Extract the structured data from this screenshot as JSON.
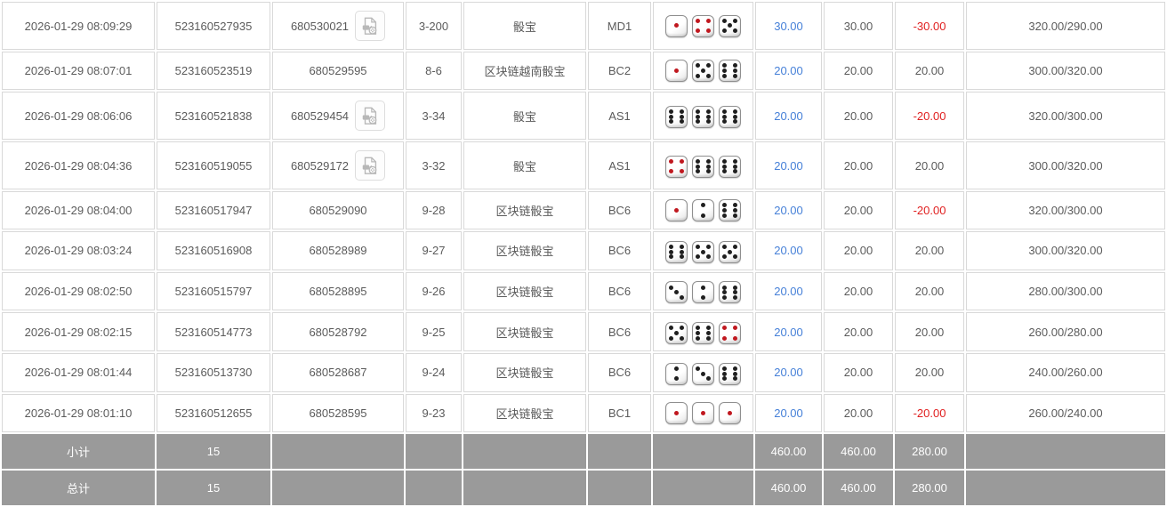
{
  "colors": {
    "accent_blue": "#4680d8",
    "negative_red": "#e02020",
    "text_gray": "#5b5b5b",
    "footer_gray": "#9a9a9a",
    "cell_border": "#d9d9d9",
    "pip_red": "#c0181f",
    "pip_black": "#1f1f1f"
  },
  "icons": {
    "video_replay": "video-replay-icon"
  },
  "table": {
    "rows": [
      {
        "time": "2026-01-29 08:09:29",
        "bet_id": "523160527935",
        "round_id": "680530021",
        "has_video": true,
        "round_no": "3-200",
        "game": "骰宝",
        "table_code": "MD1",
        "dice": [
          1,
          4,
          5
        ],
        "bet_amount": "30.00",
        "valid_amount": "30.00",
        "win_loss": "-30.00",
        "balance": "320.00/290.00"
      },
      {
        "time": "2026-01-29 08:07:01",
        "bet_id": "523160523519",
        "round_id": "680529595",
        "has_video": false,
        "round_no": "8-6",
        "game": "区块链越南骰宝",
        "table_code": "BC2",
        "dice": [
          1,
          5,
          6
        ],
        "bet_amount": "20.00",
        "valid_amount": "20.00",
        "win_loss": "20.00",
        "balance": "300.00/320.00"
      },
      {
        "time": "2026-01-29 08:06:06",
        "bet_id": "523160521838",
        "round_id": "680529454",
        "has_video": true,
        "round_no": "3-34",
        "game": "骰宝",
        "table_code": "AS1",
        "dice": [
          6,
          6,
          6
        ],
        "bet_amount": "20.00",
        "valid_amount": "20.00",
        "win_loss": "-20.00",
        "balance": "320.00/300.00"
      },
      {
        "time": "2026-01-29 08:04:36",
        "bet_id": "523160519055",
        "round_id": "680529172",
        "has_video": true,
        "round_no": "3-32",
        "game": "骰宝",
        "table_code": "AS1",
        "dice": [
          4,
          6,
          6
        ],
        "bet_amount": "20.00",
        "valid_amount": "20.00",
        "win_loss": "20.00",
        "balance": "300.00/320.00"
      },
      {
        "time": "2026-01-29 08:04:00",
        "bet_id": "523160517947",
        "round_id": "680529090",
        "has_video": false,
        "round_no": "9-28",
        "game": "区块链骰宝",
        "table_code": "BC6",
        "dice": [
          1,
          2,
          6
        ],
        "bet_amount": "20.00",
        "valid_amount": "20.00",
        "win_loss": "-20.00",
        "balance": "320.00/300.00"
      },
      {
        "time": "2026-01-29 08:03:24",
        "bet_id": "523160516908",
        "round_id": "680528989",
        "has_video": false,
        "round_no": "9-27",
        "game": "区块链骰宝",
        "table_code": "BC6",
        "dice": [
          6,
          5,
          5
        ],
        "bet_amount": "20.00",
        "valid_amount": "20.00",
        "win_loss": "20.00",
        "balance": "300.00/320.00"
      },
      {
        "time": "2026-01-29 08:02:50",
        "bet_id": "523160515797",
        "round_id": "680528895",
        "has_video": false,
        "round_no": "9-26",
        "game": "区块链骰宝",
        "table_code": "BC6",
        "dice": [
          3,
          2,
          6
        ],
        "bet_amount": "20.00",
        "valid_amount": "20.00",
        "win_loss": "20.00",
        "balance": "280.00/300.00"
      },
      {
        "time": "2026-01-29 08:02:15",
        "bet_id": "523160514773",
        "round_id": "680528792",
        "has_video": false,
        "round_no": "9-25",
        "game": "区块链骰宝",
        "table_code": "BC6",
        "dice": [
          5,
          6,
          4
        ],
        "bet_amount": "20.00",
        "valid_amount": "20.00",
        "win_loss": "20.00",
        "balance": "260.00/280.00"
      },
      {
        "time": "2026-01-29 08:01:44",
        "bet_id": "523160513730",
        "round_id": "680528687",
        "has_video": false,
        "round_no": "9-24",
        "game": "区块链骰宝",
        "table_code": "BC6",
        "dice": [
          2,
          3,
          6
        ],
        "bet_amount": "20.00",
        "valid_amount": "20.00",
        "win_loss": "20.00",
        "balance": "240.00/260.00"
      },
      {
        "time": "2026-01-29 08:01:10",
        "bet_id": "523160512655",
        "round_id": "680528595",
        "has_video": false,
        "round_no": "9-23",
        "game": "区块链骰宝",
        "table_code": "BC1",
        "dice": [
          1,
          1,
          1
        ],
        "bet_amount": "20.00",
        "valid_amount": "20.00",
        "win_loss": "-20.00",
        "balance": "260.00/240.00"
      }
    ],
    "footer_rows": [
      {
        "label": "小计",
        "count": "15",
        "bet_amount": "460.00",
        "valid_amount": "460.00",
        "win_loss": "280.00"
      },
      {
        "label": "总计",
        "count": "15",
        "bet_amount": "460.00",
        "valid_amount": "460.00",
        "win_loss": "280.00"
      }
    ]
  }
}
